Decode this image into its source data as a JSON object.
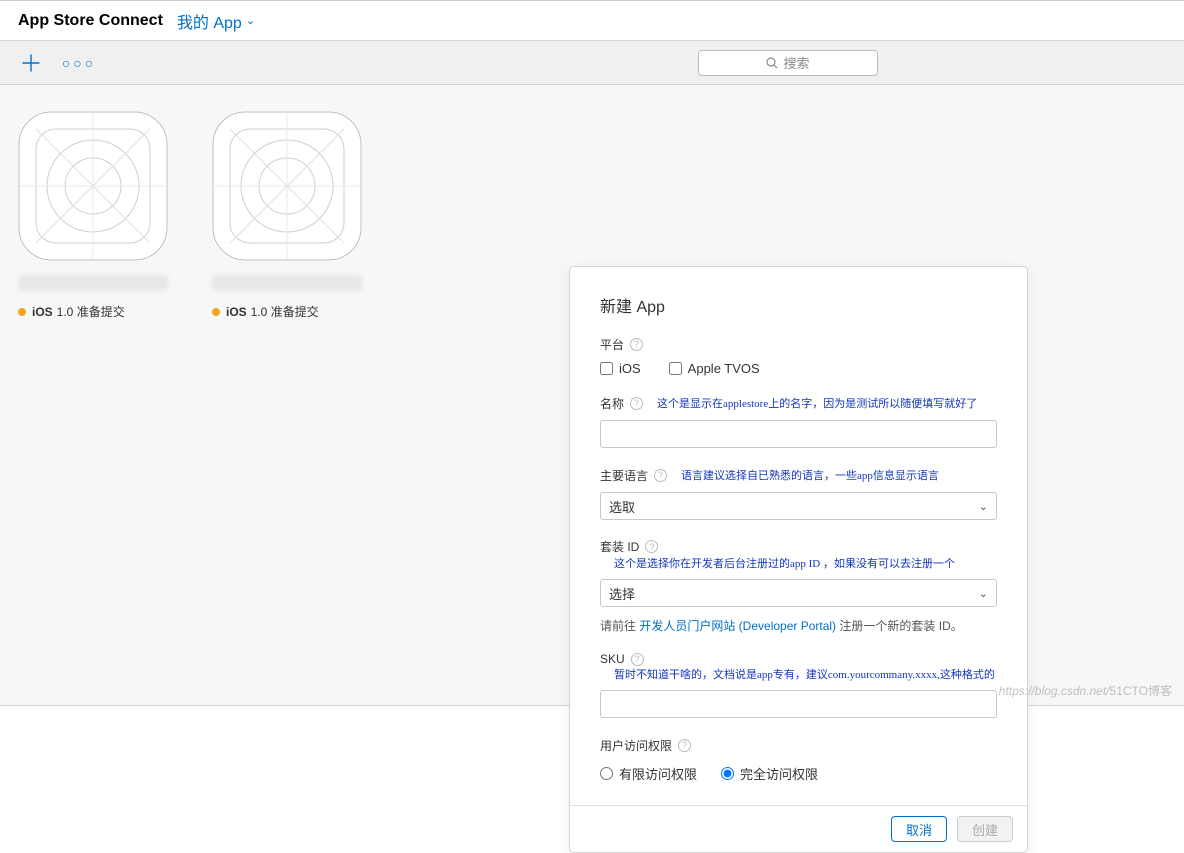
{
  "header": {
    "title": "App Store Connect",
    "link": "我的 App"
  },
  "toolbar": {
    "search_placeholder": "搜索"
  },
  "apps": [
    {
      "os": "iOS",
      "version": "1.0",
      "status": "准备提交"
    },
    {
      "os": "iOS",
      "version": "1.0",
      "status": "准备提交"
    }
  ],
  "modal": {
    "title": "新建 App",
    "platform": {
      "label": "平台",
      "opts": [
        "iOS",
        "Apple TVOS"
      ]
    },
    "name": {
      "label": "名称",
      "hint": "这个是显示在applestore上的名字，因为是测试所以随便填写就好了"
    },
    "lang": {
      "label": "主要语言",
      "hint": "语言建议选择自已熟悉的语言，一些app信息显示语言",
      "value": "选取"
    },
    "bundle": {
      "label": "套装 ID",
      "hint": "这个是选择你在开发者后台注册过的app ID ，如果没有可以去注册一个",
      "value": "选择",
      "note_pre": "请前往 ",
      "note_link": "开发人员门户网站 (Developer Portal)",
      "note_post": " 注册一个新的套装 ID。"
    },
    "sku": {
      "label": "SKU",
      "hint": "暂时不知道干啥的，文档说是app专有，建议com.yourcommany.xxxx,这种格式的"
    },
    "access": {
      "label": "用户访问权限",
      "opts": [
        "有限访问权限",
        "完全访问权限"
      ],
      "selected": 1
    },
    "buttons": {
      "cancel": "取消",
      "create": "创建"
    }
  },
  "watermark": {
    "left": "https://blog.csdn.net/",
    "right": "51CTO博客"
  }
}
